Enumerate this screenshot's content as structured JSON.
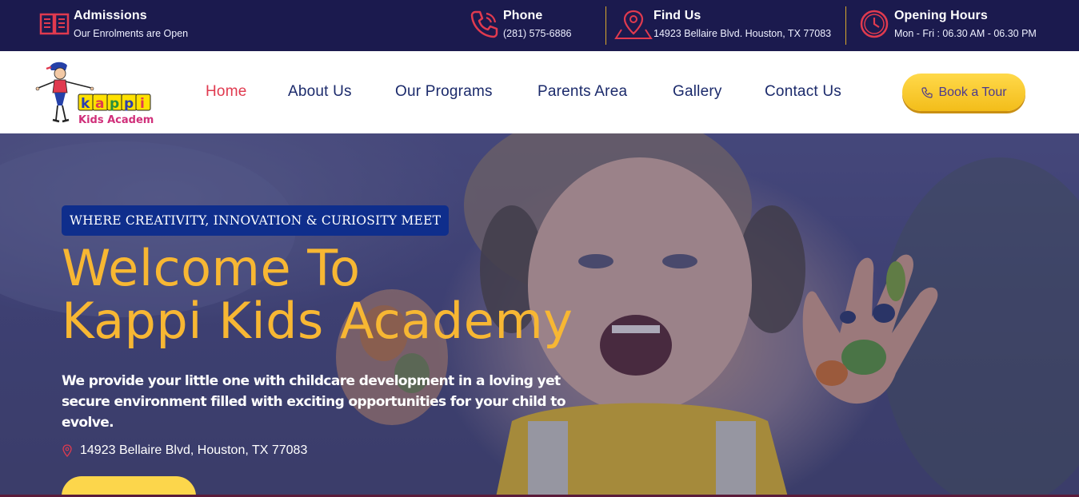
{
  "topbar": {
    "admissions": {
      "title": "Admissions",
      "subtitle": "Our Enrolments are Open"
    },
    "phone": {
      "title": "Phone",
      "subtitle": "(281) 575-6886"
    },
    "find_us": {
      "title": "Find Us",
      "subtitle": "14923 Bellaire Blvd. Houston, TX 77083"
    },
    "hours": {
      "title": "Opening Hours",
      "subtitle": "Mon - Fri : 06.30 AM - 06.30 PM"
    }
  },
  "logo": {
    "brand": "kappi",
    "sub": "Kids Academy"
  },
  "nav": {
    "items": [
      {
        "label": "Home",
        "active": true
      },
      {
        "label": "About Us"
      },
      {
        "label": "Our Programs"
      },
      {
        "label": "Parents Area"
      },
      {
        "label": "Gallery"
      },
      {
        "label": "Contact Us"
      }
    ],
    "cta": "Book a Tour"
  },
  "hero": {
    "tagline": "WHERE CREATIVITY, INNOVATION & CURIOSITY MEET",
    "title_line1": "Welcome To",
    "title_line2": "Kappi Kids Academy",
    "description": "We provide your little one with childcare development in a loving yet secure environment filled with exciting opportunities for your child to evolve.",
    "address": "14923 Bellaire Blvd, Houston, TX 77083"
  },
  "colors": {
    "topbar_bg": "#1b1a4e",
    "icon_red": "#e03a4f",
    "nav_text": "#1b2a6b",
    "cta_yellow": "#fcd64b",
    "hero_title": "#f7b733",
    "tagline_bg": "#0f2e8c"
  },
  "icons": [
    "book-icon",
    "phone-icon",
    "map-pin-icon",
    "clock-icon",
    "phone-small-icon",
    "location-pin-icon"
  ]
}
